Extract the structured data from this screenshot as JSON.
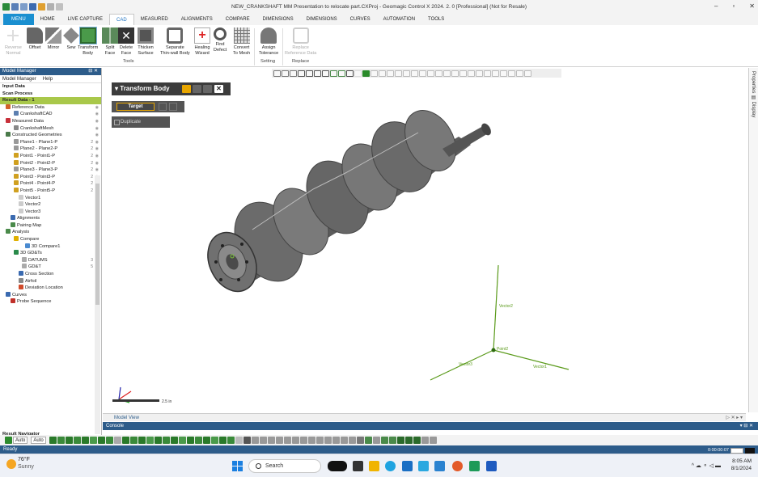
{
  "window": {
    "title": "NEW_CRANKSHAFT MM Presentation to relocate part.CXProj - Geomagic Control X 2024. 2. 0 [Professional] (Not for Resale)"
  },
  "ribbon_tabs": [
    "MENU",
    "HOME",
    "LIVE CAPTURE",
    "CAD",
    "MEASURED",
    "ALIGNMENTS",
    "COMPARE",
    "DIMENSIONS",
    "DIMENSIONS",
    "CURVES",
    "AUTOMATION",
    "TOOLS"
  ],
  "ribbon": {
    "buttons": [
      {
        "label": "Reverse\nNormal"
      },
      {
        "label": "Offset"
      },
      {
        "label": "Mirror"
      },
      {
        "label": "Sew"
      },
      {
        "label": "Transform\nBody"
      },
      {
        "label": "Split\nFace"
      },
      {
        "label": "Delete\nFace"
      },
      {
        "label": "Thicken\nSurface"
      },
      {
        "label": "Separate\nThin-wall Body"
      },
      {
        "label": "Healing\nWizard"
      },
      {
        "label": "Find\nDefect"
      },
      {
        "label": "Convert\nTo Mesh"
      },
      {
        "label": "Assign\nTolerance"
      },
      {
        "label": "Replace\nReference Data"
      }
    ],
    "groups": [
      "Tools",
      "Setting",
      "Replace"
    ]
  },
  "model_manager": {
    "title": "Model Manager",
    "tabs": [
      "Model Manager",
      "Help"
    ],
    "rows": [
      {
        "label": "Input Data",
        "count": ""
      },
      {
        "label": "Scan Process",
        "count": ""
      },
      {
        "label": "Result Data - 1",
        "count": ""
      },
      {
        "label": "Reference Data",
        "count": ""
      },
      {
        "label": "CrankshaftCAD",
        "count": ""
      },
      {
        "label": "Measured Data",
        "count": ""
      },
      {
        "label": "CrankshaftMesh",
        "count": ""
      },
      {
        "label": "Constructed Geometries",
        "count": ""
      },
      {
        "label": "Plane1 - Plane1-P",
        "count": "2"
      },
      {
        "label": "Plane2 - Plane2-P",
        "count": "2"
      },
      {
        "label": "Point1 - Point1-P",
        "count": "2"
      },
      {
        "label": "Point2 - Point2-P",
        "count": "2"
      },
      {
        "label": "Plane3 - Plane3-P",
        "count": "2"
      },
      {
        "label": "Point3 - Point3-P",
        "count": "2"
      },
      {
        "label": "Point4 - Point4-P",
        "count": "2"
      },
      {
        "label": "Point5 - Point5-P",
        "count": "2"
      },
      {
        "label": "Vector1",
        "count": ""
      },
      {
        "label": "Vector2",
        "count": ""
      },
      {
        "label": "Vector3",
        "count": ""
      },
      {
        "label": "Alignments",
        "count": ""
      },
      {
        "label": "Pairing Map",
        "count": ""
      },
      {
        "label": "Analysis",
        "count": ""
      },
      {
        "label": "Compare",
        "count": ""
      },
      {
        "label": "3D Compare1",
        "count": ""
      },
      {
        "label": "3D GD&Ts",
        "count": ""
      },
      {
        "label": "DATUMS",
        "count": "3"
      },
      {
        "label": "GD&T",
        "count": "5"
      },
      {
        "label": "Cross Section",
        "count": ""
      },
      {
        "label": "Airfoil",
        "count": ""
      },
      {
        "label": "Deviation Location",
        "count": ""
      },
      {
        "label": "Curves",
        "count": ""
      },
      {
        "label": "Probe Sequence",
        "count": ""
      }
    ],
    "navigator_title": "Result Navigator"
  },
  "transform_panel": {
    "title": "Transform Body",
    "target_label": "Target",
    "duplicate_label": "Duplicate"
  },
  "viewport": {
    "vector_labels": [
      "Vector2",
      "Vector1",
      "Vector3"
    ],
    "origin_label": "Point2",
    "scale_label": "2.5 in"
  },
  "bottom_tabs": {
    "model_view": "Model View",
    "console": "Console"
  },
  "bottom_toolbar": {
    "select1": "Auto",
    "select2": "Auto"
  },
  "status": {
    "ready": "Ready",
    "time": "0:00:00:07"
  },
  "taskbar": {
    "weather_temp": "76°F",
    "weather_desc": "Sunny",
    "search_placeholder": "Search",
    "time": "8:05 AM",
    "date": "8/1/2024"
  },
  "colors": {
    "accent": "#1a8fd0",
    "panel_dark": "#3c3c3c",
    "highlight": "#a9c84a",
    "vector_green": "#5a9a1a"
  }
}
